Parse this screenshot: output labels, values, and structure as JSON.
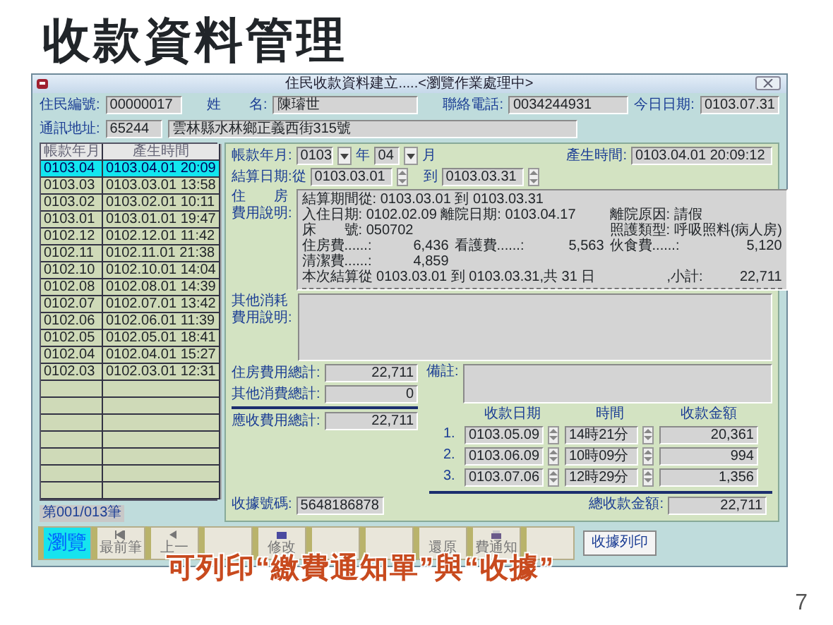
{
  "slide": {
    "title": "收款資料管理",
    "caption": "可列印“繳費通知單”與“收據”",
    "page_number": "7"
  },
  "window": {
    "title": "住民收款資料建立.....<瀏覽作業處理中>"
  },
  "header_fields": [
    {
      "label": "住民編號:",
      "value": "00000017",
      "kind": "short"
    },
    {
      "label": "姓　　名:",
      "value": "陳璿世",
      "kind": "wide"
    },
    {
      "label": "聯絡電話:",
      "value": "0034244931",
      "kind": "medium"
    },
    {
      "label": "今日日期:",
      "value": "0103.07.31",
      "kind": "right"
    }
  ],
  "address": {
    "label": "通訊地址:",
    "zip": "65244",
    "value": "雲林縣水林鄉正義西街315號"
  },
  "list": {
    "columns": [
      "帳款年月",
      "產生時間"
    ],
    "rows": [
      {
        "month": "0103.04",
        "created": "0103.04.01 20:09",
        "selected": true
      },
      {
        "month": "0103.03",
        "created": "0103.03.01 13:58",
        "selected": false
      },
      {
        "month": "0103.02",
        "created": "0103.02.01 10:11",
        "selected": false
      },
      {
        "month": "0103.01",
        "created": "0103.01.01 19:47",
        "selected": false
      },
      {
        "month": "0102.12",
        "created": "0102.12.01 11:42",
        "selected": false
      },
      {
        "month": "0102.11",
        "created": "0102.11.01 21:38",
        "selected": false
      },
      {
        "month": "0102.10",
        "created": "0102.10.01 14:04",
        "selected": false
      },
      {
        "month": "0102.08",
        "created": "0102.08.01 14:39",
        "selected": false
      },
      {
        "month": "0102.07",
        "created": "0102.07.01 13:42",
        "selected": false
      },
      {
        "month": "0102.06",
        "created": "0102.06.01 11:39",
        "selected": false
      },
      {
        "month": "0102.05",
        "created": "0102.05.01 18:41",
        "selected": false
      },
      {
        "month": "0102.04",
        "created": "0102.04.01 15:27",
        "selected": false
      },
      {
        "month": "0102.03",
        "created": "0102.03.01 12:31",
        "selected": false
      }
    ],
    "record_counter": "第001/013筆"
  },
  "period": {
    "label": "帳款年月:",
    "year": "0103",
    "year_unit": "年",
    "month": "04",
    "month_unit": "月",
    "created_label": "產生時間:",
    "created": "0103.04.01 20:09:12"
  },
  "settlement": {
    "label": "結算日期:從",
    "from": "0103.03.01",
    "to_label": "到",
    "to": "0103.03.31"
  },
  "housing": {
    "label": [
      "住　　房",
      "費用說明:"
    ],
    "lines": [
      {
        "kind": "plain",
        "segments": [
          "結算期間從: 0103.03.01 到 0103.03.31"
        ]
      },
      {
        "kind": "pair",
        "segments": [
          "入住日期: 0102.02.09  離院日期: 0103.04.17",
          "離院原因: 請假"
        ]
      },
      {
        "kind": "pair",
        "segments": [
          "床　　號: 050702",
          "照護類型: 呼吸照料(病人房)"
        ]
      },
      {
        "kind": "amounts",
        "segments": [
          "住房費......:",
          "6,436",
          "看護費......:",
          "5,563",
          "伙食費......:",
          "5,120"
        ]
      },
      {
        "kind": "amounts",
        "segments": [
          "清潔費......:",
          "4,859"
        ]
      },
      {
        "kind": "subtotal",
        "segments": [
          "本次結算從 0103.03.01 到 0103.03.31,共 31 日",
          ",小計:",
          "22,711"
        ]
      }
    ]
  },
  "other": {
    "label": [
      "其他消耗",
      "費用說明:"
    ]
  },
  "totals": [
    {
      "label": "住房費用總計:",
      "value": "22,711"
    },
    {
      "label": "其他消費總計:",
      "value": "0"
    },
    {
      "label": "應收費用總計:",
      "value": "22,711"
    }
  ],
  "remark": {
    "label": "備註:"
  },
  "payments": {
    "columns": [
      "收款日期",
      "時間",
      "收款金額"
    ],
    "rows": [
      {
        "no": "1.",
        "date": "0103.05.09",
        "time": "14時21分",
        "amount": "20,361"
      },
      {
        "no": "2.",
        "date": "0103.06.09",
        "time": "10時09分",
        "amount": "994"
      },
      {
        "no": "3.",
        "date": "0103.07.06",
        "time": "12時29分",
        "amount": "1,356"
      }
    ]
  },
  "receipt": {
    "label": "收據號碼:",
    "value": "5648186878",
    "total_label": "總收款金額:",
    "total": "22,711"
  },
  "toolbar": [
    {
      "label": "瀏覽",
      "kind": "plain",
      "selected": true
    },
    {
      "label": "最前筆",
      "kind": "first",
      "selected": false
    },
    {
      "label": "上一",
      "kind": "prev",
      "selected": false
    },
    {
      "kind": "plain",
      "selected": false
    },
    {
      "label": "修改",
      "kind": "edit",
      "selected": false
    },
    {
      "kind": "plain",
      "selected": false
    },
    {
      "kind": "plain",
      "selected": false
    },
    {
      "label": "還原",
      "kind": "plain",
      "selected": false
    },
    {
      "label": "費通知",
      "kind": "printer",
      "selected": false
    },
    {
      "kind": "plain",
      "selected": false
    }
  ],
  "print_button": {
    "label": "收據列印"
  }
}
